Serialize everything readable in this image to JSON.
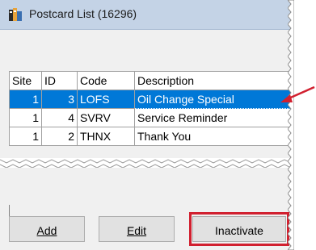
{
  "window": {
    "title": "Postcard List (16296)"
  },
  "table": {
    "headers": [
      "Site",
      "ID",
      "Code",
      "Description"
    ],
    "rows": [
      {
        "site": "1",
        "id": "3",
        "code": "LOFS",
        "description": "Oil Change Special",
        "selected": true
      },
      {
        "site": "1",
        "id": "4",
        "code": "SVRV",
        "description": "Service Reminder",
        "selected": false
      },
      {
        "site": "1",
        "id": "2",
        "code": "THNX",
        "description": "Thank You",
        "selected": false
      }
    ]
  },
  "buttons": {
    "add": "Add",
    "edit": "Edit",
    "inactivate": "Inactivate"
  },
  "colors": {
    "selection": "#0078d7",
    "highlight": "#d1202f",
    "titlebar": "#c4d3e6"
  }
}
